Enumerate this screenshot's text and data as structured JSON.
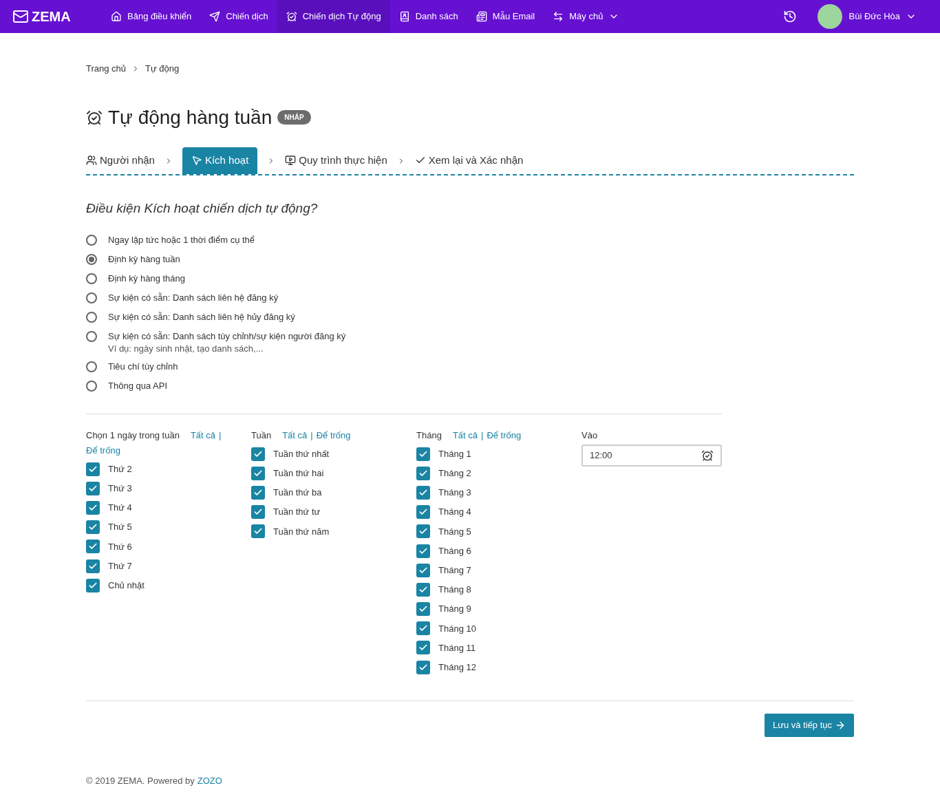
{
  "nav": {
    "logo": "ZEMA",
    "items": [
      {
        "label": "Bảng điều khiển",
        "selected": false,
        "dropdown": false
      },
      {
        "label": "Chiến dịch",
        "selected": false,
        "dropdown": false
      },
      {
        "label": "Chiến dịch Tự động",
        "selected": true,
        "dropdown": false
      },
      {
        "label": "Danh sách",
        "selected": false,
        "dropdown": false
      },
      {
        "label": "Mẫu Email",
        "selected": false,
        "dropdown": false
      },
      {
        "label": "Máy chủ",
        "selected": false,
        "dropdown": true
      }
    ],
    "user": "Bùi Đức Hòa"
  },
  "breadcrumb": [
    "Trang chủ",
    "Tự động"
  ],
  "title": "Tự động hàng tuần",
  "badge": "NHÁP",
  "steps": [
    {
      "label": "Người nhận",
      "selected": false
    },
    {
      "label": "Kích hoạt",
      "selected": true
    },
    {
      "label": "Quy trình thực hiện",
      "selected": false
    },
    {
      "label": "Xem lại và Xác nhận",
      "selected": false
    }
  ],
  "question": "Điều kiện Kích hoạt chiến dịch tự động?",
  "options": [
    {
      "label": "Ngay lập tức hoặc 1 thời điểm cụ thể",
      "selected": false
    },
    {
      "label": "Định kỳ hàng tuần",
      "selected": true
    },
    {
      "label": "Định kỳ hàng tháng",
      "selected": false
    },
    {
      "label": "Sự kiện có sẵn: Danh sách liên hệ đăng ký",
      "selected": false
    },
    {
      "label": "Sự kiện có sẵn: Danh sách liên hệ hủy đăng ký",
      "selected": false
    },
    {
      "label": "Sự kiện có sẵn: Danh sách tùy chỉnh/sự kiện người đăng ký",
      "selected": false,
      "hint": "Ví dụ: ngày sinh nhật, tạo danh sách,..."
    },
    {
      "label": "Tiêu chí tùy chỉnh",
      "selected": false
    },
    {
      "label": "Thông qua API",
      "selected": false
    }
  ],
  "groups": [
    {
      "title": "Chọn 1 ngày trong tuần",
      "all": "Tất cả",
      "separator": "|",
      "none": "Để trống",
      "items": [
        {
          "label": "Thứ 2",
          "checked": true
        },
        {
          "label": "Thứ 3",
          "checked": true
        },
        {
          "label": "Thứ 4",
          "checked": true
        },
        {
          "label": "Thứ 5",
          "checked": true
        },
        {
          "label": "Thứ 6",
          "checked": true
        },
        {
          "label": "Thứ 7",
          "checked": true
        },
        {
          "label": "Chủ nhật",
          "checked": true
        }
      ]
    },
    {
      "title": "Tuần",
      "all": "Tất cả",
      "separator": "|",
      "none": "Để trống",
      "items": [
        {
          "label": "Tuần thứ nhất",
          "checked": true
        },
        {
          "label": "Tuần thứ hai",
          "checked": true
        },
        {
          "label": "Tuần thứ ba",
          "checked": true
        },
        {
          "label": "Tuần thứ tư",
          "checked": true
        },
        {
          "label": "Tuần thứ năm",
          "checked": true
        }
      ]
    },
    {
      "title": "Tháng",
      "all": "Tất cả",
      "separator": "|",
      "none": "Để trống",
      "items": [
        {
          "label": "Tháng 1",
          "checked": true
        },
        {
          "label": "Tháng 2",
          "checked": true
        },
        {
          "label": "Tháng 3",
          "checked": true
        },
        {
          "label": "Tháng 4",
          "checked": true
        },
        {
          "label": "Tháng 5",
          "checked": true
        },
        {
          "label": "Tháng 6",
          "checked": true
        },
        {
          "label": "Tháng 7",
          "checked": true
        },
        {
          "label": "Tháng 8",
          "checked": true
        },
        {
          "label": "Tháng 9",
          "checked": true
        },
        {
          "label": "Tháng 10",
          "checked": true
        },
        {
          "label": "Tháng 11",
          "checked": true
        },
        {
          "label": "Tháng 12",
          "checked": true
        }
      ]
    }
  ],
  "time": {
    "label": "Vào",
    "value": "12:00"
  },
  "save_button": "Lưu và tiếp tục",
  "footer": {
    "text": "© 2019 ZEMA. Powered by",
    "link": "ZOZO"
  }
}
